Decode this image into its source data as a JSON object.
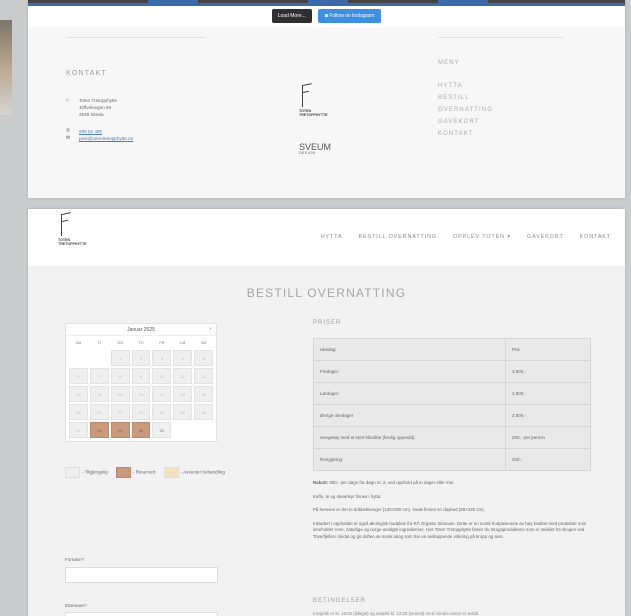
{
  "top": {
    "load_more": "Load More...",
    "follow_instagram": "Follow on Instagram",
    "kontakt_title": "KONTAKT",
    "address_lines": [
      "Toten Tretopphytte",
      "Jeffvelvegen 69",
      "2848 Skreia"
    ],
    "phone": "930 52 406",
    "email": "post@totentretopphytte.no",
    "logo_text": [
      "TOTEN",
      "TRETOPPHYTTE"
    ],
    "sveum_text": "SVEUM",
    "sveum_sub": "DESIGN",
    "meny_title": "MENY",
    "meny_items": [
      "HYTTA",
      "BESTILL",
      "OVERNATTING",
      "GAVEKORT",
      "KONTAKT"
    ]
  },
  "header": {
    "logo_text": [
      "TOTEN",
      "TRETOPPHYTTE"
    ],
    "nav": [
      "HYTTA",
      "BESTILL OVERNATTING",
      "OPPLEV TOTEN ▾",
      "GAVEKORT",
      "KONTAKT"
    ]
  },
  "page_title": "BESTILL OVERNATTING",
  "calendar": {
    "month": "Januar 2025",
    "next_icon": "›",
    "days_of_week": [
      "MA",
      "TI",
      "ON",
      "TO",
      "FR",
      "LØ",
      "SØ"
    ],
    "weeks": [
      [
        "",
        "",
        "1",
        "2",
        "3",
        "4",
        "5"
      ],
      [
        "6",
        "7",
        "8",
        "9",
        "10",
        "11",
        "12"
      ],
      [
        "13",
        "14",
        "15",
        "16",
        "17",
        "18",
        "19"
      ],
      [
        "20",
        "21",
        "22",
        "23",
        "24",
        "25",
        "26"
      ],
      [
        "27",
        "28",
        "29",
        "30",
        "31",
        "",
        ""
      ]
    ],
    "reserved_days": [
      "28",
      "29",
      "30"
    ],
    "current_days": [
      "31"
    ]
  },
  "legend": {
    "available": "- Tilgjengelig",
    "reserved": "- Reservert",
    "pending": "- Avventer behandling",
    "colors": {
      "available": "#eeeeee",
      "reserved": "#c99a7c",
      "pending": "#f5e2bd"
    }
  },
  "form": {
    "fornavn_label": "Fornavn*:",
    "etternavn_label": "Etternavn*:"
  },
  "priser": {
    "title": "PRISER",
    "rows": [
      {
        "label": "Ukedag",
        "value": "Pris"
      },
      {
        "label": "Fredager",
        "value": "3.800,-"
      },
      {
        "label": "Lørdager",
        "value": "4.800,-"
      },
      {
        "label": "Øvrige ukedager",
        "value": "2.800,-"
      },
      {
        "label": "Sengetøy med et stort håndkle (ferdig oppredd)",
        "value": "200,- per person"
      },
      {
        "label": "Rengjøring",
        "value": "400,-"
      }
    ]
  },
  "notes": {
    "rabatt_bold": "Rabatt:",
    "rabatt_text": " 800,- per døgn fra døgn nr. 2, ved opphold på to dager eller mer.",
    "line2": "Kaffe, te og steamkyr finnes i hytta.",
    "line3": "På hemsen er det to dobbeltsenger (140×200 cm). Nede finnes en daybed (80×225 cm).",
    "line4": "Inkludert i oppholdet er også økologisk hudpleie fra RÅ Organic Skincare. Dette er en norsk hudpleieserie av høy kvalitet med produkter som inneholder rene, naturlige og norge-utvalgte ingredienser. Hos Toten Tretopphytte finner du Skogsproduktene som er utviklet fra skogen ved Toverfjellet i Alvdal og gir duften av norsk skog som har en avslappende virkning på kropp og sinn."
  },
  "betingelser": {
    "title": "BETINGELSER",
    "text": "Innsjekk er kl. 15:00 (tidligst) og utsjekk kl. 12:00 (senest) med mindre annet er avtalt."
  }
}
